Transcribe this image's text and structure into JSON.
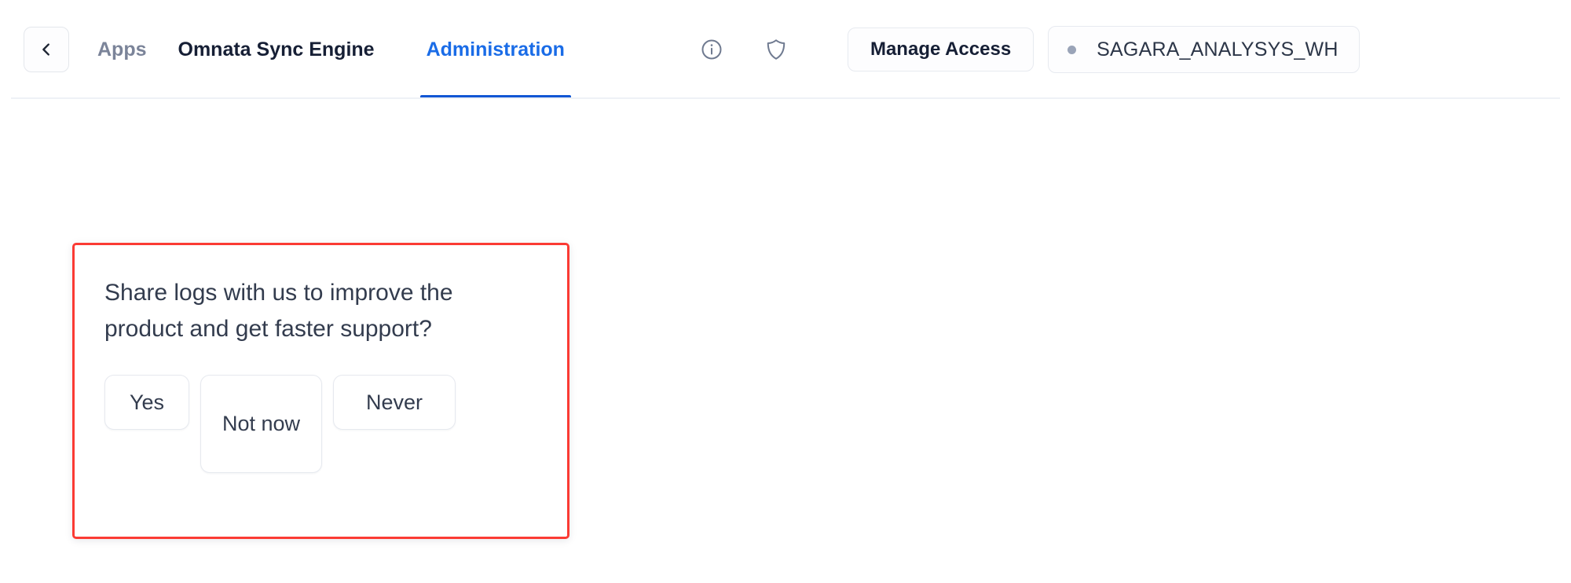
{
  "header": {
    "back_button": {
      "icon": "chevron-left-icon",
      "label": ""
    },
    "breadcrumb_apps": "Apps",
    "app_title": "Omnata Sync Engine",
    "tab_administration": "Administration",
    "icons": [
      {
        "name": "info-icon",
        "semantic": "info-circle"
      },
      {
        "name": "shield-icon",
        "semantic": "security-shield"
      }
    ],
    "manage_access_label": "Manage Access",
    "warehouse": {
      "name": "SAGARA_ANALYSYS_WH",
      "status_dot_color": "#9aa4b8"
    },
    "active_tab_color": "#1a6ce7",
    "active_underline_color": "#1257d4"
  },
  "consent_card": {
    "highlight_border_color": "#fb3b34",
    "question": "Share logs with us to improve the product and get faster support?",
    "buttons": {
      "yes": "Yes",
      "not_now": "Not now",
      "never": "Never"
    }
  }
}
